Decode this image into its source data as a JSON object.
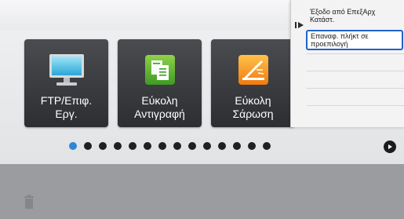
{
  "home": {
    "tiles": [
      {
        "label_line1": "FTP/Επιφ.",
        "label_line2": "Εργ.",
        "icon": "monitor-icon"
      },
      {
        "label_line1": "Εύκολη",
        "label_line2": "Αντιγραφή",
        "icon": "copy-icon"
      },
      {
        "label_line1": "Εύκολη",
        "label_line2": "Σάρωση",
        "icon": "scan-icon"
      }
    ],
    "page_indicator": {
      "total_pages": 14,
      "current_page": 1
    }
  },
  "action_menu": {
    "items": [
      {
        "label": "Έξοδο από ΕπεξΑρχ Κατάστ."
      },
      {
        "label": "Επαναφ. πλήκτ σε προεπιλογή"
      }
    ]
  },
  "colors": {
    "accent_blue": "#2e86d7",
    "selection_border": "#1f63c9",
    "tile_dark": "#2c2e31"
  }
}
